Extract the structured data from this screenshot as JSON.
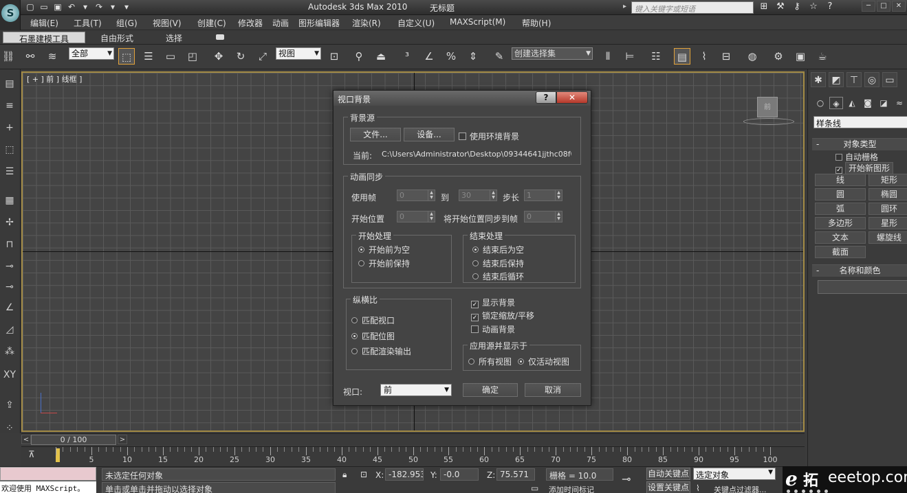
{
  "title_bar": {
    "app_title": "Autodesk 3ds Max  2010",
    "doc_title": "无标题",
    "search_placeholder": "键入关键字或短语",
    "window_controls": [
      "─",
      "□",
      "✕"
    ]
  },
  "menu": [
    "编辑(E)",
    "工具(T)",
    "组(G)",
    "视图(V)",
    "创建(C)",
    "修改器",
    "动画",
    "图形编辑器",
    "渲染(R)",
    "自定义(U)",
    "MAXScript(M)",
    "帮助(H)"
  ],
  "ribbon_tabs": [
    "石墨建模工具",
    "自由形式",
    "选择"
  ],
  "toolbar": {
    "selection_filter": "全部",
    "ref_coord": "视图",
    "named_selection": "创建选择集"
  },
  "viewport": {
    "label": "[ + ] 前 ] 线框 ]"
  },
  "command_panel": {
    "category": "样条线",
    "object_type_title": "对象类型",
    "auto_grid": "自动栅格",
    "start_new_shape": "开始新图形",
    "buttons": [
      "线",
      "矩形",
      "圆",
      "椭圆",
      "弧",
      "圆环",
      "多边形",
      "星形",
      "文本",
      "螺旋线",
      "截面"
    ],
    "name_color_title": "名称和颜色"
  },
  "time_slider": {
    "position": "0 / 100"
  },
  "track_labels": [
    "5",
    "10",
    "15",
    "20",
    "25",
    "30",
    "35",
    "40",
    "45",
    "50",
    "55",
    "60",
    "65",
    "70",
    "75",
    "80",
    "85",
    "90",
    "95",
    "100"
  ],
  "status": {
    "maxscript_text": "欢迎使用 MAXScript。",
    "prompt": "未选定任何对象",
    "hint": "单击或单击并拖动以选择对象",
    "x_label": "X:",
    "x_value": "-182.953",
    "y_label": "Y:",
    "y_value": "-0.0",
    "z_label": "Z:",
    "z_value": "75.571",
    "grid": "栅格 = 10.0",
    "auto_key": "自动关键点",
    "selected_set": "选定对象",
    "set_key": "设置关键点",
    "key_filters": "关键点过滤器...",
    "add_time_tag": "添加时间标记"
  },
  "watermark": {
    "logo": "e",
    "cn": "拓",
    "en": "eeetop.com"
  },
  "dialog": {
    "title": "视口背景",
    "help": "?",
    "close": "✕",
    "background_source": "背景源",
    "files_btn": "文件...",
    "devices_btn": "设备...",
    "use_env_bg": "使用环境背景",
    "current_label": "当前:",
    "current_path": "C:\\Users\\Administrator\\Desktop\\09344641jjthc08f0m10u",
    "anim_sync": "动画同步",
    "use_frame": "使用帧",
    "use_frame_val": "0",
    "to": "到",
    "to_val": "30",
    "step": "步长",
    "step_val": "1",
    "start_at": "开始位置",
    "start_at_val": "0",
    "sync_start": "将开始位置同步到帧",
    "sync_start_val": "0",
    "start_processing": "开始处理",
    "blank_before": "开始前为空",
    "hold_before": "开始前保持",
    "end_processing": "结束处理",
    "blank_after": "结束后为空",
    "hold_after": "结束后保持",
    "loop_after": "结束后循环",
    "aspect": "纵横比",
    "match_viewport": "匹配视口",
    "match_bitmap": "匹配位图",
    "match_render": "匹配渲染输出",
    "display_bg": "显示背景",
    "lock_zoom": "锁定缩放/平移",
    "animate_bg": "动画背景",
    "apply_title": "应用源并显示于",
    "all_views": "所有视图",
    "active_only": "仅活动视图",
    "viewport_label": "视口:",
    "viewport_value": "前",
    "ok": "确定",
    "cancel": "取消"
  }
}
